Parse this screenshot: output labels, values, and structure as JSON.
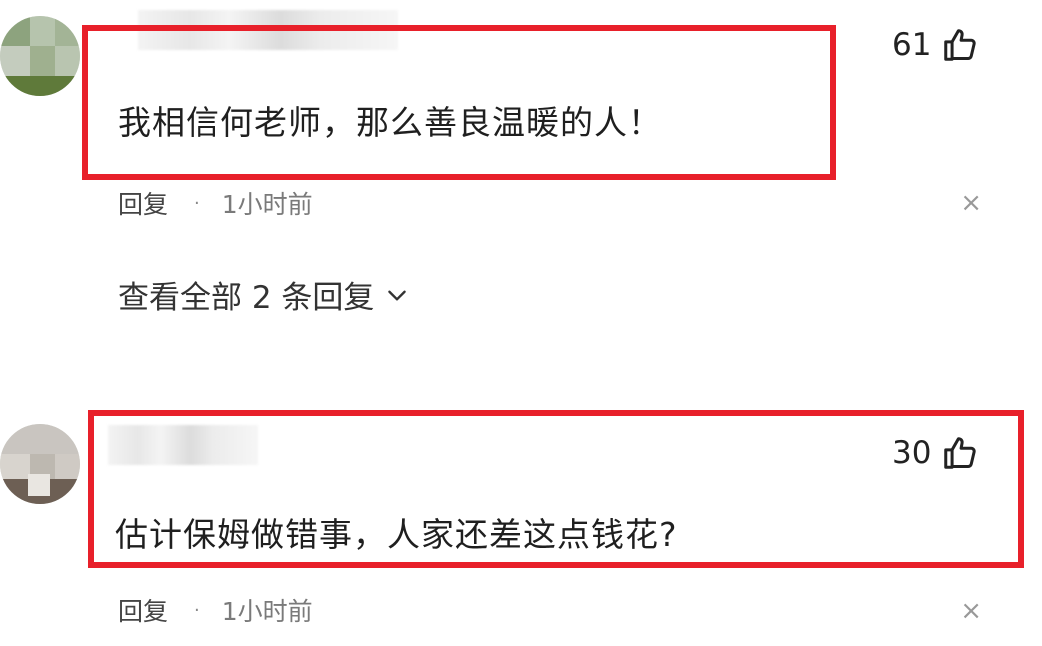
{
  "comments": [
    {
      "text": "我相信何老师，那么善良温暖的人！",
      "likes": "61",
      "reply_label": "回复",
      "separator": "·",
      "time": "1小时前",
      "close_glyph": "×"
    },
    {
      "text": "估计保姆做错事，人家还差这点钱花?",
      "likes": "30",
      "reply_label": "回复",
      "separator": "·",
      "time": "1小时前",
      "close_glyph": "×"
    }
  ],
  "view_all_replies": "查看全部 2 条回复",
  "icons": {
    "like": "thumbs-up-icon",
    "expand": "chevron-down-icon",
    "close": "close-icon"
  },
  "colors": {
    "highlight_border": "#e8202a"
  }
}
